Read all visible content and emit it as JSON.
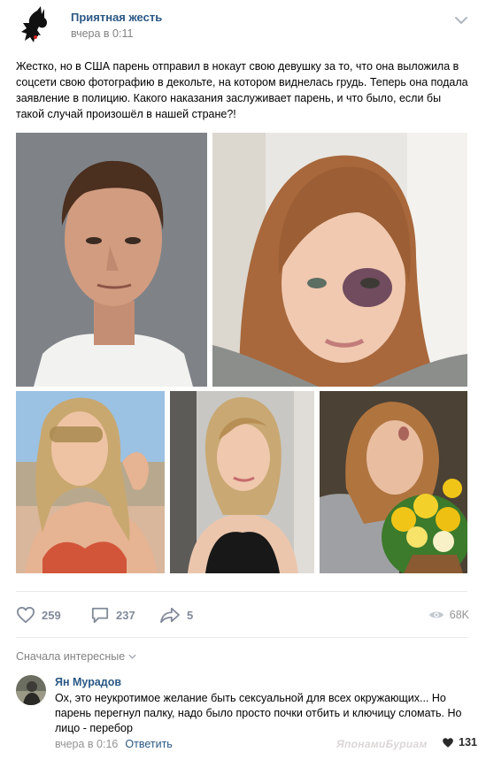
{
  "post": {
    "author": "Приятная жесть",
    "time": "вчера в 0:11",
    "text": "Жестко, но в США парень отправил в нокаут свою девушку за то, что она выложила в соцсети свою фотографию в декольте, на котором виднелась грудь. Теперь она подала заявление в полицию. Какого наказания заслуживает парень, и что было, если бы такой случай произошёл в нашей стране?!"
  },
  "actions": {
    "likes": "259",
    "comments": "237",
    "shares": "5",
    "views": "68K"
  },
  "comments_section": {
    "sort_label": "Сначала интересные"
  },
  "comment": {
    "author": "Ян Мурадов",
    "text": "Ох, это неукротимое желание быть сексуальной для всех окружающих... Но парень перегнул палку, надо было просто почки отбить и ключицу сломать. Но лицо - перебор",
    "time": "вчера в 0:16",
    "reply_label": "Ответить",
    "likes": "131"
  },
  "watermark": "ЯпонамиБуриам",
  "colors": {
    "link": "#2a5885",
    "muted": "#828282",
    "icon": "#828a99"
  }
}
